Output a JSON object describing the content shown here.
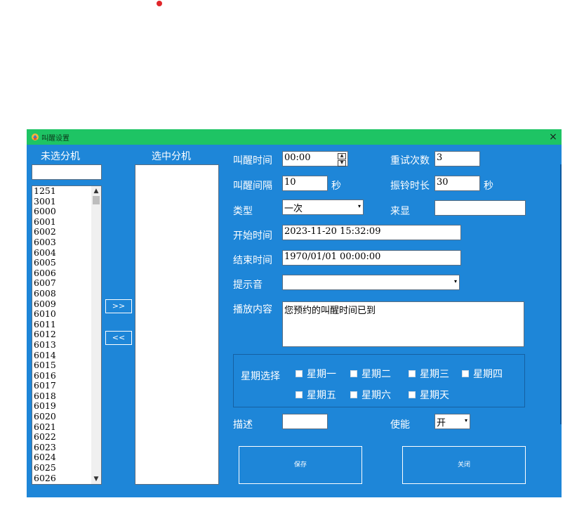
{
  "window": {
    "title": "叫醒设置",
    "close_glyph": "×"
  },
  "left_panel": {
    "unselected_header": "未选分机",
    "selected_header": "选中分机",
    "search_value": "",
    "extensions": [
      "1251",
      "3001",
      "6000",
      "6001",
      "6002",
      "6003",
      "6004",
      "6005",
      "6006",
      "6007",
      "6008",
      "6009",
      "6010",
      "6011",
      "6012",
      "6013",
      "6014",
      "6015",
      "6016",
      "6017",
      "6018",
      "6019",
      "6020",
      "6021",
      "6022",
      "6023",
      "6024",
      "6025",
      "6026"
    ],
    "add_label": ">>",
    "remove_label": "<<"
  },
  "form": {
    "wake_time_label": "叫醒时间",
    "wake_time_value": "00:00",
    "retry_label": "重试次数",
    "retry_value": "3",
    "interval_label": "叫醒间隔",
    "interval_value": "10",
    "interval_unit": "秒",
    "ring_label": "振铃时长",
    "ring_value": "30",
    "ring_unit": "秒",
    "type_label": "类型",
    "type_value": "一次",
    "caller_label": "来显",
    "caller_value": "",
    "start_label": "开始时间",
    "start_value": "2023-11-20 15:32:09",
    "end_label": "结束时间",
    "end_value": "1970/01/01 00:00:00",
    "tone_label": "提示音",
    "tone_value": "",
    "content_label": "播放内容",
    "content_value": "您预约的叫醒时间已到",
    "week_label": "星期选择",
    "weekdays": [
      "星期一",
      "星期二",
      "星期三",
      "星期四",
      "星期五",
      "星期六",
      "星期天"
    ],
    "desc_label": "描述",
    "desc_value": "",
    "enable_label": "使能",
    "enable_value": "开"
  },
  "buttons": {
    "save": "保存",
    "close": "关闭"
  },
  "icons": {
    "combo_arrow": "▾",
    "spin_up": "▲",
    "spin_down": "▼",
    "scroll_up": "▲",
    "scroll_down": "▼"
  }
}
